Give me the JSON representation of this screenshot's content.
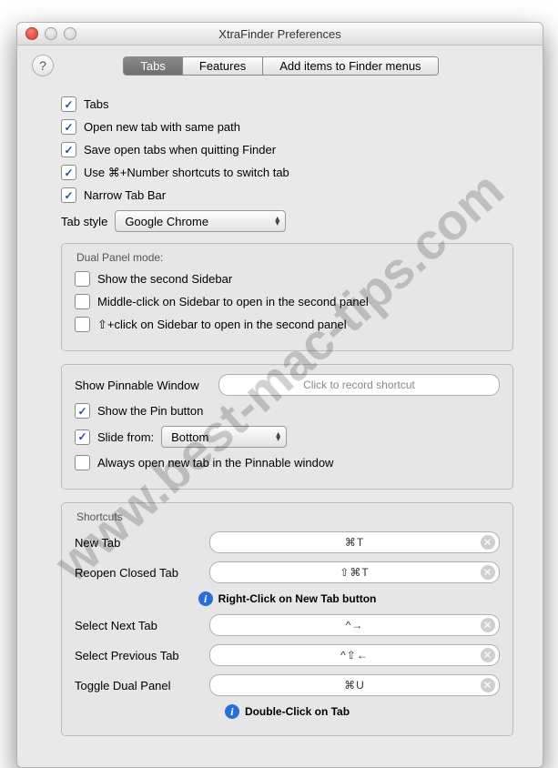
{
  "window": {
    "title": "XtraFinder Preferences"
  },
  "tabs": {
    "items": [
      "Tabs",
      "Features",
      "Add items to Finder menus"
    ],
    "active_index": 0
  },
  "options": {
    "tabs": {
      "label": "Tabs",
      "checked": true
    },
    "same_path": {
      "label": "Open new tab with same path",
      "checked": true
    },
    "save_tabs": {
      "label": "Save open tabs when quitting Finder",
      "checked": true
    },
    "cmd_number": {
      "label": "Use ⌘+Number shortcuts to switch tab",
      "checked": true
    },
    "narrow_bar": {
      "label": "Narrow Tab Bar",
      "checked": true
    },
    "tab_style_label": "Tab style",
    "tab_style_value": "Google Chrome"
  },
  "dual_panel": {
    "legend": "Dual Panel mode:",
    "second_sidebar": {
      "label": "Show the second Sidebar",
      "checked": false
    },
    "middle_click": {
      "label": "Middle-click on Sidebar to open in the second panel",
      "checked": false
    },
    "shift_click": {
      "label": "⇧+click on Sidebar to open in the second panel",
      "checked": false
    }
  },
  "pinnable": {
    "show_window_label": "Show Pinnable Window",
    "record_placeholder": "Click to record shortcut",
    "show_pin": {
      "label": "Show the Pin button",
      "checked": true
    },
    "slide_from_label": "Slide from:",
    "slide_from_value": "Bottom",
    "slide_from_checked": true,
    "always_open": {
      "label": "Always open new tab in the Pinnable window",
      "checked": false
    }
  },
  "shortcuts": {
    "legend": "Shortcuts",
    "new_tab": {
      "label": "New Tab",
      "keys": "⌘T"
    },
    "reopen": {
      "label": "Reopen Closed Tab",
      "keys": "⇧⌘T"
    },
    "hint1": "Right-Click on New Tab button",
    "next_tab": {
      "label": "Select Next Tab",
      "keys": "^→"
    },
    "prev_tab": {
      "label": "Select Previous Tab",
      "keys": "^⇧←"
    },
    "toggle_dual": {
      "label": "Toggle Dual Panel",
      "keys": "⌘U"
    },
    "hint2": "Double-Click on Tab"
  },
  "watermark": "www.best-mac-tips.com"
}
